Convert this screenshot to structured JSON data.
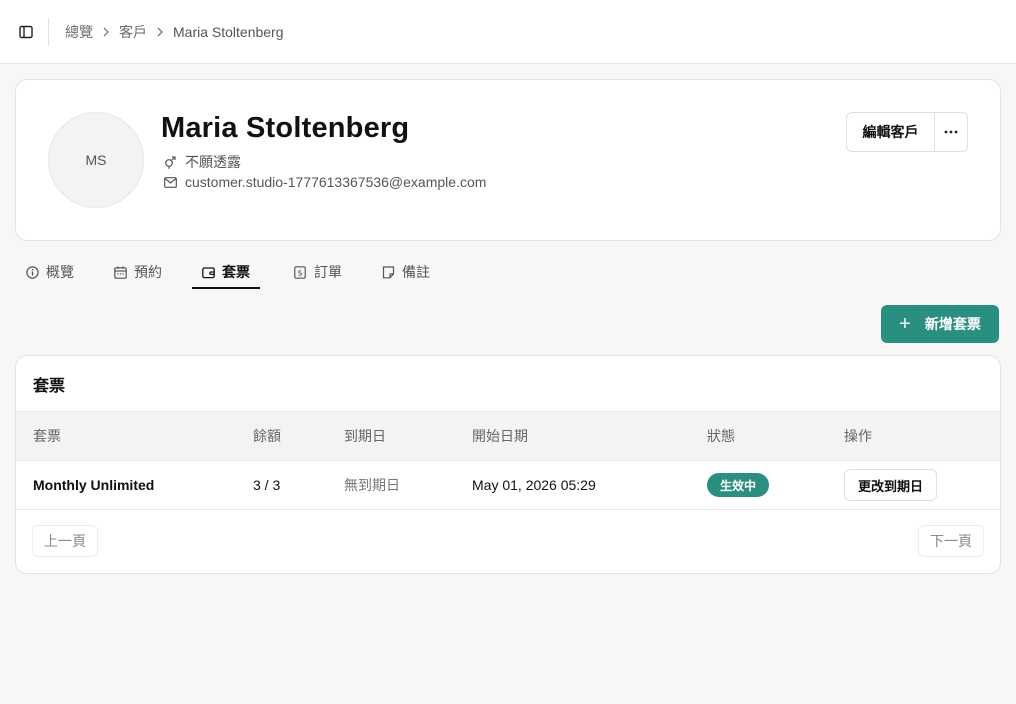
{
  "breadcrumb": {
    "overview": "總覽",
    "customers": "客戶",
    "current": "Maria Stoltenberg"
  },
  "profile": {
    "initials": "MS",
    "name": "Maria Stoltenberg",
    "gender": "不願透露",
    "email": "customer.studio-1777613367536@example.com",
    "edit_label": "編輯客戶",
    "more_label": "···"
  },
  "tabs": [
    {
      "label": "概覽",
      "icon": "info-icon"
    },
    {
      "label": "預約",
      "icon": "calendar-icon"
    },
    {
      "label": "套票",
      "icon": "wallet-icon",
      "active": true
    },
    {
      "label": "訂單",
      "icon": "receipt-icon"
    },
    {
      "label": "備註",
      "icon": "note-icon"
    }
  ],
  "add_button": {
    "label": "新增套票",
    "icon": "plus-icon"
  },
  "table": {
    "title": "套票",
    "headers": [
      "套票",
      "餘額",
      "到期日",
      "開始日期",
      "狀態",
      "操作"
    ],
    "rows": [
      {
        "pass": "Monthly Unlimited",
        "balance": "3 / 3",
        "expiry": "無到期日",
        "start": "May 01, 2026 05:29",
        "status": "生效中",
        "action": "更改到期日"
      }
    ],
    "prev_label": "上一頁",
    "next_label": "下一頁"
  },
  "colors": {
    "accent": "#2a8f80",
    "background": "#f7f7f6"
  }
}
